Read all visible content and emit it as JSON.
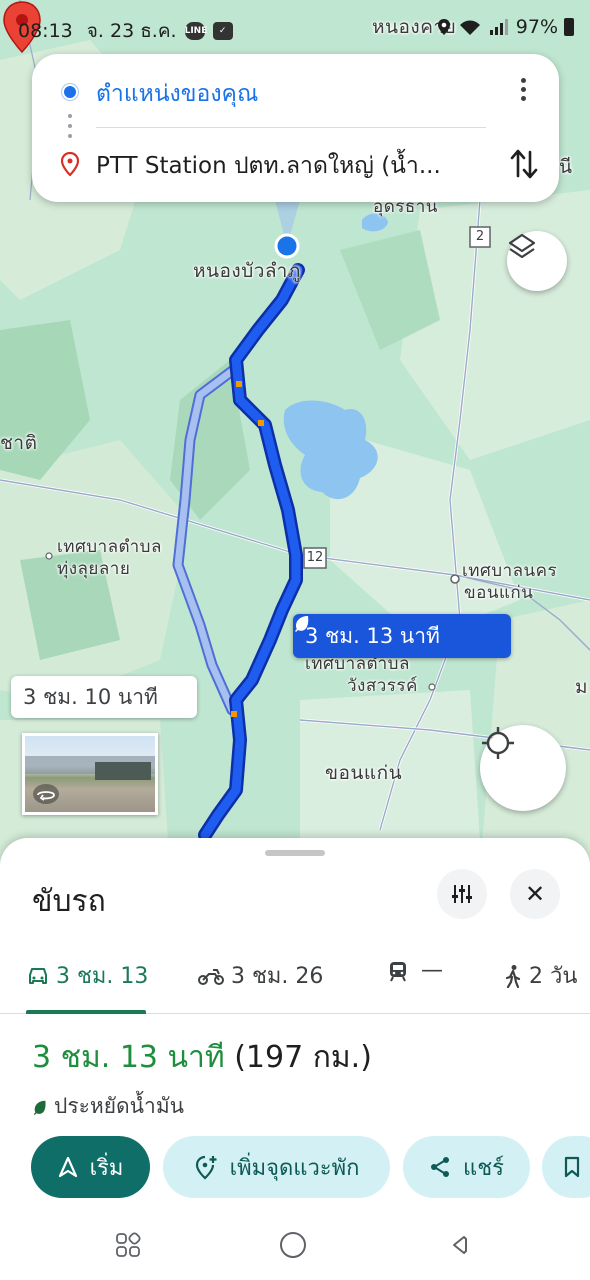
{
  "status_bar": {
    "time": "08:13",
    "date": "จ. 23 ธ.ค.",
    "battery": "97%"
  },
  "directions": {
    "origin": "ตำแหน่งของคุณ",
    "destination": "PTT Station ปตท.ลาดใหญ่ (น้ำ..."
  },
  "map": {
    "labels": {
      "nong_khai": "หนองคาย",
      "udon_thani": "อุดรธานี",
      "nong_bua_lamphu": "หนองบัวลำภู",
      "chati": "ชาติ",
      "thung_lum_lai_line1": "เทศบาลตำบล",
      "thung_lum_lai_line2": "ทุ่งลุยลาย",
      "khon_kaen_city_line1": "เทศบาลนคร",
      "khon_kaen_city_line2": "ขอนแก่น",
      "wang_sawan_line1": "เทศบาลตำบล",
      "wang_sawan_line2": "วังสวรรค์",
      "khon_kaen": "ขอนแก่น",
      "edge_ni": "นี",
      "edge_mo": "ม"
    },
    "highway_2": "2",
    "highway_12": "12",
    "route_main_time": "3 ชม. 13 นาที",
    "route_alt_time": "3 ชม. 10 นาที"
  },
  "sheet": {
    "title": "ขับรถ",
    "close_label": "✕",
    "modes": [
      {
        "label": "3 ชม. 13",
        "icon": "car-icon",
        "active": true
      },
      {
        "label": "3 ชม. 26",
        "icon": "motorcycle-icon",
        "active": false
      },
      {
        "label": "—",
        "icon": "transit-icon",
        "active": false
      },
      {
        "label": "2 วัน",
        "icon": "walk-icon",
        "active": false
      }
    ],
    "route_time": "3 ชม. 13 นาที",
    "route_distance": "(197 กม.)",
    "eco_label": "ประหยัดน้ำมัน",
    "actions": {
      "start": "เริ่ม",
      "add_stop": "เพิ่มจุดแวะพัก",
      "share": "แชร์"
    }
  },
  "colors": {
    "route_primary": "#1a56db",
    "route_alt": "#a8c0f0",
    "accent_green": "#1e8e3e",
    "start_button": "#0f6e68"
  }
}
